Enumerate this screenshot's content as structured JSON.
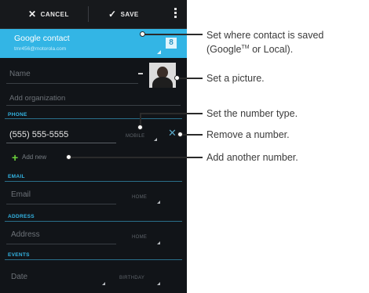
{
  "action_bar": {
    "cancel_label": "CANCEL",
    "save_label": "SAVE",
    "cancel_icon": "close-icon",
    "save_icon": "check-icon"
  },
  "account": {
    "title": "Google contact",
    "email": "tmr456@motorola.com"
  },
  "fields": {
    "name_placeholder": "Name",
    "organization_placeholder": "Add organization",
    "phone_section": "PHONE",
    "phone_value": "(555) 555-5555",
    "phone_type": "MOBILE",
    "add_new_label": "Add new",
    "email_section": "EMAIL",
    "email_placeholder": "Email",
    "email_type": "HOME",
    "address_section": "ADDRESS",
    "address_placeholder": "Address",
    "address_type": "HOME",
    "events_section": "EVENTS",
    "date_placeholder": "Date",
    "date_type": "BIRTHDAY"
  },
  "annotations": {
    "account_line1": "Set where contact is saved",
    "account_line2a": "(Google",
    "account_tm": "TM",
    "account_line2b": " or Local).",
    "picture": "Set a picture.",
    "number_type": "Set the number type.",
    "remove": "Remove a number.",
    "add": "Add another number."
  },
  "colors": {
    "accent": "#33b5e5",
    "background": "#111418",
    "add_green": "#6bd13b"
  }
}
